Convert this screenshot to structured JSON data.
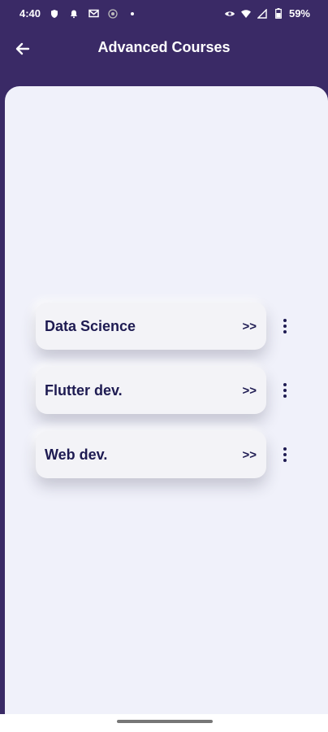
{
  "status_bar": {
    "time": "4:40",
    "battery": "59%",
    "left_icons": [
      "shield-icon",
      "bell-icon",
      "gmail-icon",
      "chrome-icon",
      "dot-icon"
    ],
    "right_icons": [
      "eye-icon",
      "wifi-icon",
      "signal-icon",
      "battery-icon"
    ]
  },
  "app_bar": {
    "title": "Advanced Courses",
    "back_icon": "arrow-left-icon"
  },
  "courses": [
    {
      "label": "Data Science",
      "arrow": ">>"
    },
    {
      "label": "Flutter dev.",
      "arrow": ">>"
    },
    {
      "label": "Web dev.",
      "arrow": ">>"
    }
  ],
  "colors": {
    "header_bg": "#3a2a66",
    "content_bg": "#f0f1fa",
    "card_bg": "#f3f3f7",
    "text_primary": "#1e1b52"
  }
}
